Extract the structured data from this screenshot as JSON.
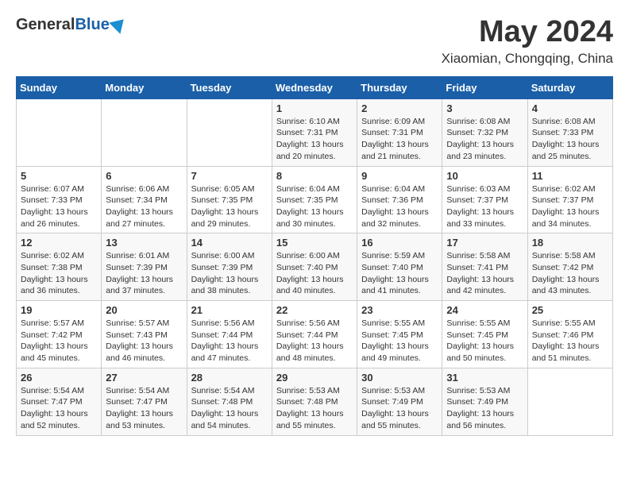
{
  "header": {
    "logo_general": "General",
    "logo_blue": "Blue",
    "month_title": "May 2024",
    "location": "Xiaomian, Chongqing, China"
  },
  "days_of_week": [
    "Sunday",
    "Monday",
    "Tuesday",
    "Wednesday",
    "Thursday",
    "Friday",
    "Saturday"
  ],
  "weeks": [
    [
      {
        "day": "",
        "info": ""
      },
      {
        "day": "",
        "info": ""
      },
      {
        "day": "",
        "info": ""
      },
      {
        "day": "1",
        "info": "Sunrise: 6:10 AM\nSunset: 7:31 PM\nDaylight: 13 hours and 20 minutes."
      },
      {
        "day": "2",
        "info": "Sunrise: 6:09 AM\nSunset: 7:31 PM\nDaylight: 13 hours and 21 minutes."
      },
      {
        "day": "3",
        "info": "Sunrise: 6:08 AM\nSunset: 7:32 PM\nDaylight: 13 hours and 23 minutes."
      },
      {
        "day": "4",
        "info": "Sunrise: 6:08 AM\nSunset: 7:33 PM\nDaylight: 13 hours and 25 minutes."
      }
    ],
    [
      {
        "day": "5",
        "info": "Sunrise: 6:07 AM\nSunset: 7:33 PM\nDaylight: 13 hours and 26 minutes."
      },
      {
        "day": "6",
        "info": "Sunrise: 6:06 AM\nSunset: 7:34 PM\nDaylight: 13 hours and 27 minutes."
      },
      {
        "day": "7",
        "info": "Sunrise: 6:05 AM\nSunset: 7:35 PM\nDaylight: 13 hours and 29 minutes."
      },
      {
        "day": "8",
        "info": "Sunrise: 6:04 AM\nSunset: 7:35 PM\nDaylight: 13 hours and 30 minutes."
      },
      {
        "day": "9",
        "info": "Sunrise: 6:04 AM\nSunset: 7:36 PM\nDaylight: 13 hours and 32 minutes."
      },
      {
        "day": "10",
        "info": "Sunrise: 6:03 AM\nSunset: 7:37 PM\nDaylight: 13 hours and 33 minutes."
      },
      {
        "day": "11",
        "info": "Sunrise: 6:02 AM\nSunset: 7:37 PM\nDaylight: 13 hours and 34 minutes."
      }
    ],
    [
      {
        "day": "12",
        "info": "Sunrise: 6:02 AM\nSunset: 7:38 PM\nDaylight: 13 hours and 36 minutes."
      },
      {
        "day": "13",
        "info": "Sunrise: 6:01 AM\nSunset: 7:39 PM\nDaylight: 13 hours and 37 minutes."
      },
      {
        "day": "14",
        "info": "Sunrise: 6:00 AM\nSunset: 7:39 PM\nDaylight: 13 hours and 38 minutes."
      },
      {
        "day": "15",
        "info": "Sunrise: 6:00 AM\nSunset: 7:40 PM\nDaylight: 13 hours and 40 minutes."
      },
      {
        "day": "16",
        "info": "Sunrise: 5:59 AM\nSunset: 7:40 PM\nDaylight: 13 hours and 41 minutes."
      },
      {
        "day": "17",
        "info": "Sunrise: 5:58 AM\nSunset: 7:41 PM\nDaylight: 13 hours and 42 minutes."
      },
      {
        "day": "18",
        "info": "Sunrise: 5:58 AM\nSunset: 7:42 PM\nDaylight: 13 hours and 43 minutes."
      }
    ],
    [
      {
        "day": "19",
        "info": "Sunrise: 5:57 AM\nSunset: 7:42 PM\nDaylight: 13 hours and 45 minutes."
      },
      {
        "day": "20",
        "info": "Sunrise: 5:57 AM\nSunset: 7:43 PM\nDaylight: 13 hours and 46 minutes."
      },
      {
        "day": "21",
        "info": "Sunrise: 5:56 AM\nSunset: 7:44 PM\nDaylight: 13 hours and 47 minutes."
      },
      {
        "day": "22",
        "info": "Sunrise: 5:56 AM\nSunset: 7:44 PM\nDaylight: 13 hours and 48 minutes."
      },
      {
        "day": "23",
        "info": "Sunrise: 5:55 AM\nSunset: 7:45 PM\nDaylight: 13 hours and 49 minutes."
      },
      {
        "day": "24",
        "info": "Sunrise: 5:55 AM\nSunset: 7:45 PM\nDaylight: 13 hours and 50 minutes."
      },
      {
        "day": "25",
        "info": "Sunrise: 5:55 AM\nSunset: 7:46 PM\nDaylight: 13 hours and 51 minutes."
      }
    ],
    [
      {
        "day": "26",
        "info": "Sunrise: 5:54 AM\nSunset: 7:47 PM\nDaylight: 13 hours and 52 minutes."
      },
      {
        "day": "27",
        "info": "Sunrise: 5:54 AM\nSunset: 7:47 PM\nDaylight: 13 hours and 53 minutes."
      },
      {
        "day": "28",
        "info": "Sunrise: 5:54 AM\nSunset: 7:48 PM\nDaylight: 13 hours and 54 minutes."
      },
      {
        "day": "29",
        "info": "Sunrise: 5:53 AM\nSunset: 7:48 PM\nDaylight: 13 hours and 55 minutes."
      },
      {
        "day": "30",
        "info": "Sunrise: 5:53 AM\nSunset: 7:49 PM\nDaylight: 13 hours and 55 minutes."
      },
      {
        "day": "31",
        "info": "Sunrise: 5:53 AM\nSunset: 7:49 PM\nDaylight: 13 hours and 56 minutes."
      },
      {
        "day": "",
        "info": ""
      }
    ]
  ]
}
